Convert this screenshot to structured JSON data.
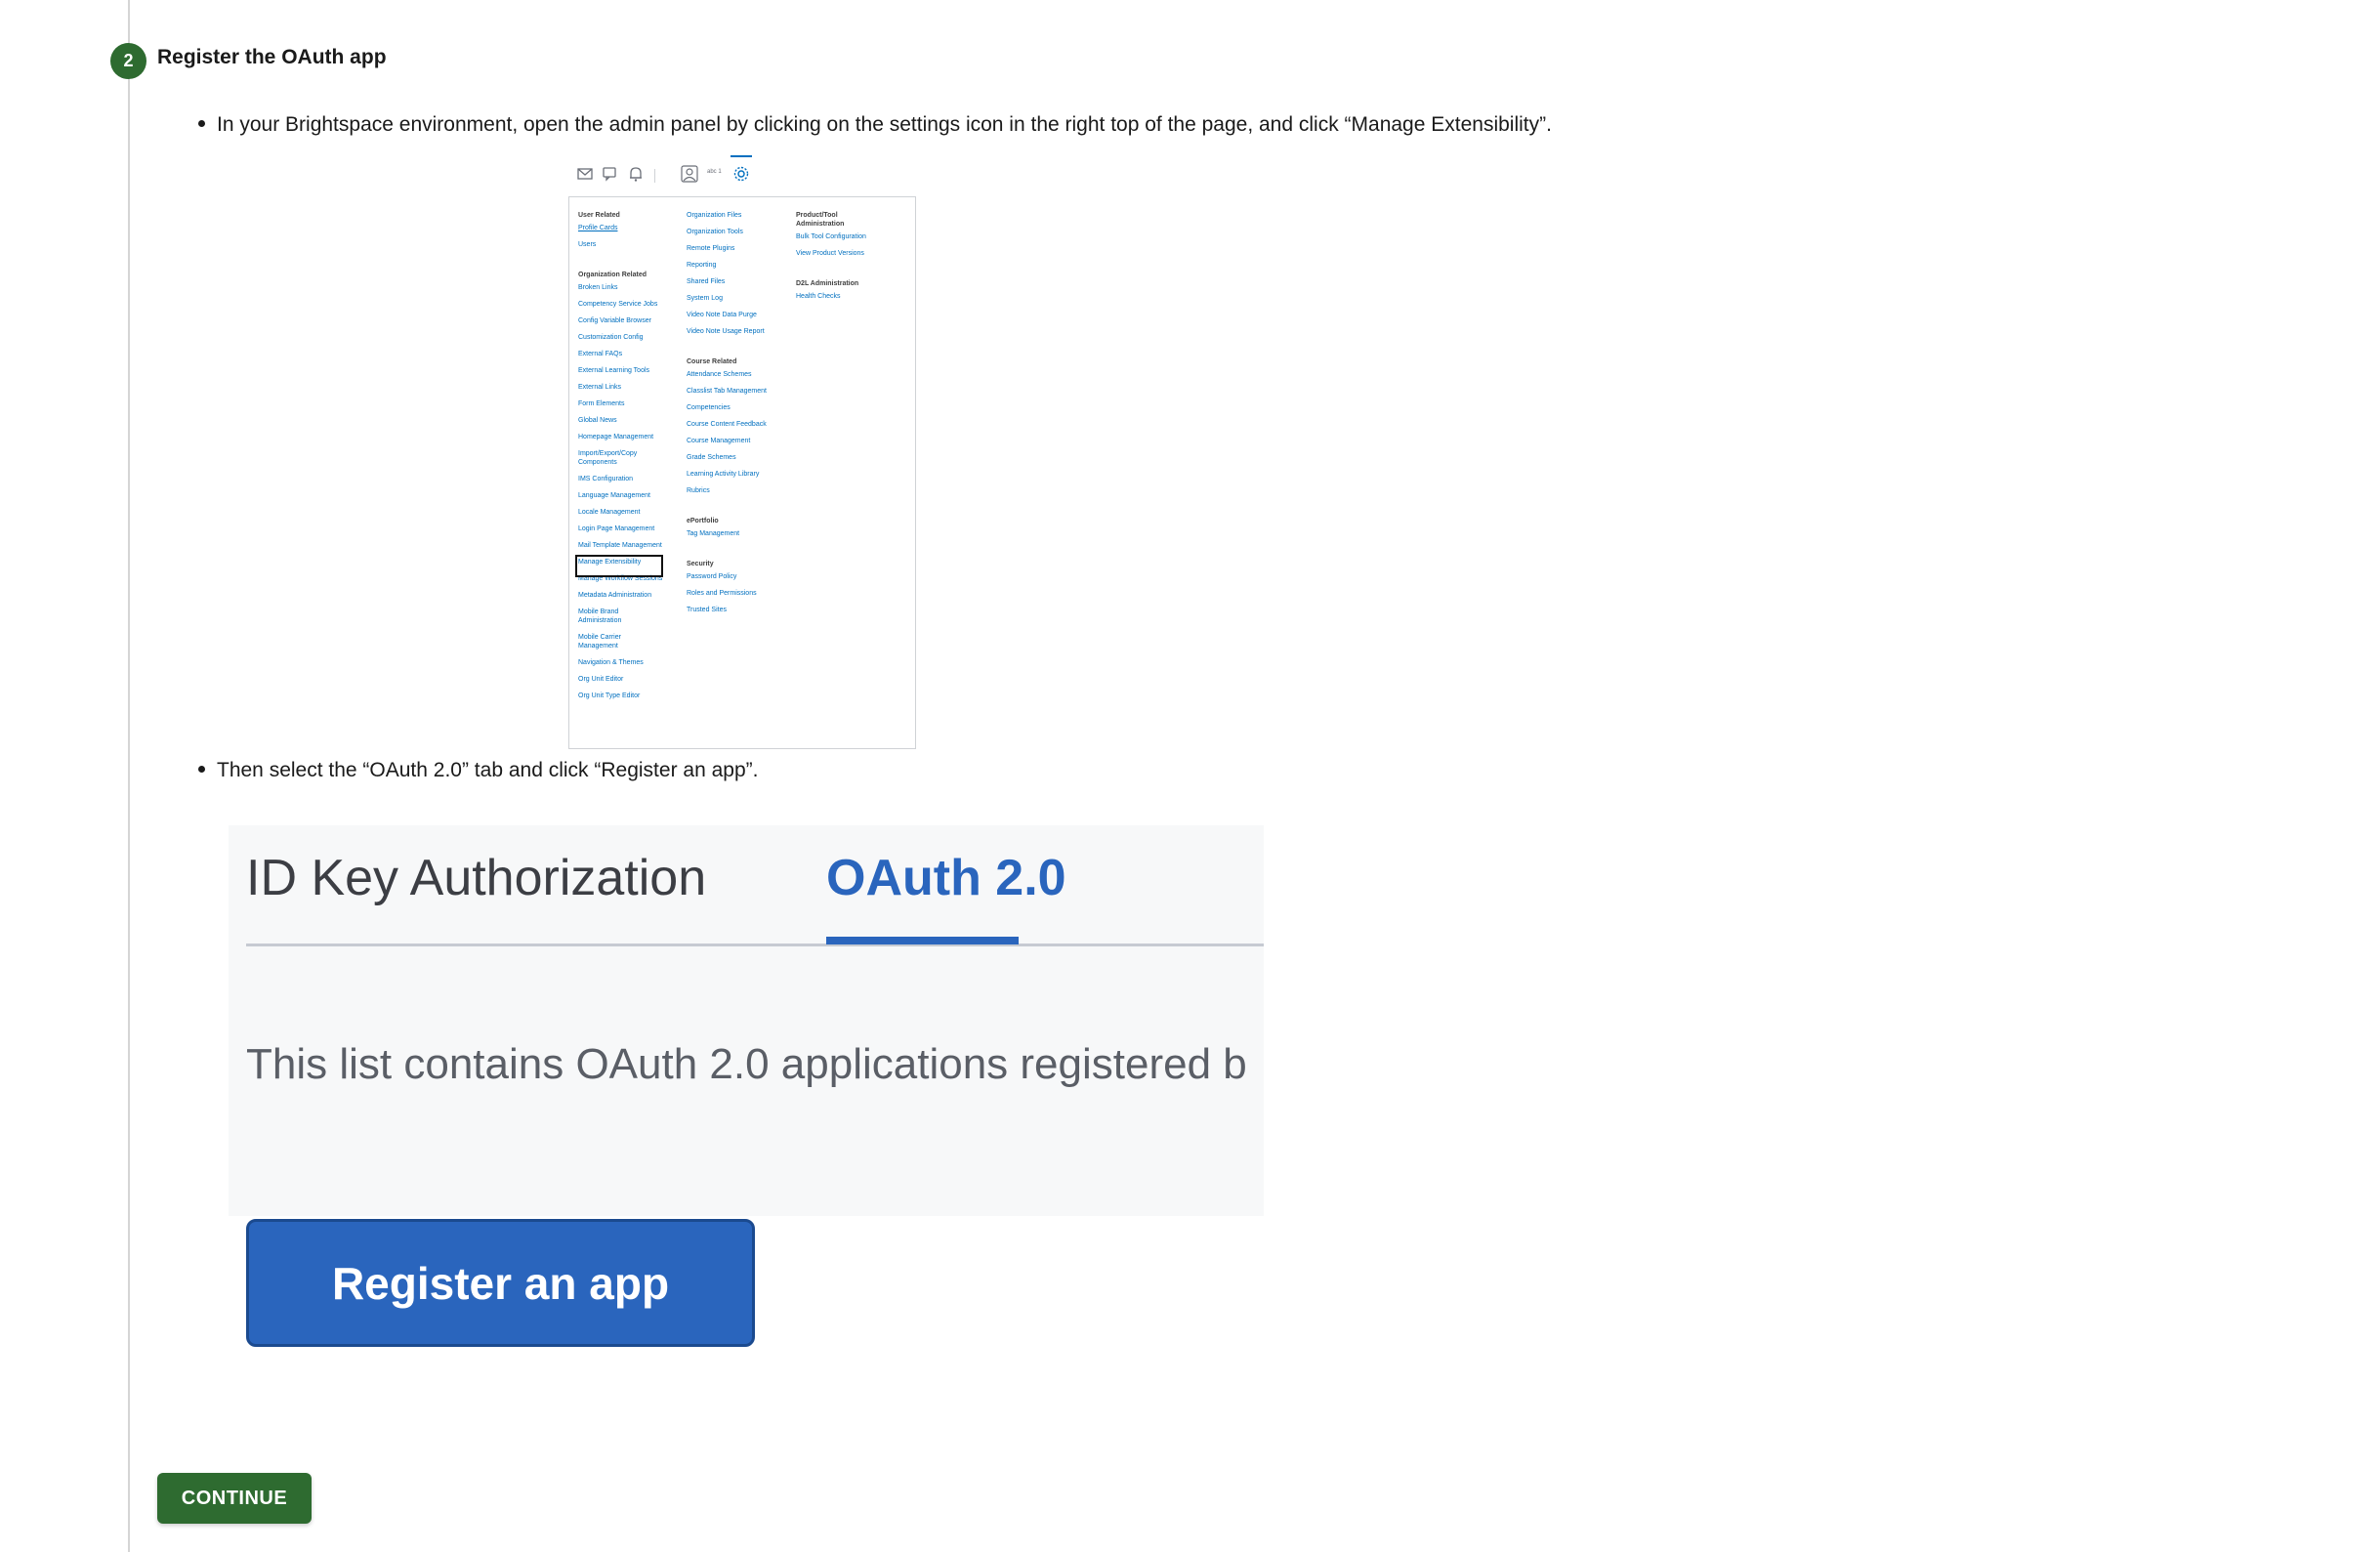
{
  "step": {
    "number": "2",
    "title": "Register the OAuth app"
  },
  "instructions": {
    "bullet1": "In your Brightspace environment, open the admin panel by clicking on the settings icon in the right top of the page, and click “Manage Extensibility”.",
    "bullet2": "Then select the “OAuth 2.0” tab and click “Register an app”."
  },
  "admin_panel": {
    "toolbar_icons": [
      "mail-icon",
      "chat-icon",
      "bell-icon",
      "user-icon",
      "gear-icon"
    ],
    "user_label": "abc 1",
    "col1": {
      "user_related": "User Related",
      "profile_cards": "Profile Cards",
      "users": "Users",
      "org_related": "Organization Related",
      "items": [
        "Broken Links",
        "Competency Service Jobs",
        "Config Variable Browser",
        "Customization Config",
        "External FAQs",
        "External Learning Tools",
        "External Links",
        "Form Elements",
        "Global News",
        "Homepage Management",
        "Import/Export/Copy Components",
        "IMS Configuration",
        "Language Management",
        "Locale Management",
        "Login Page Management",
        "Mail Template Management",
        "Manage Extensibility",
        "Manage Workflow Sessions",
        "Metadata Administration",
        "Mobile Brand Administration",
        "Mobile Carrier Management",
        "Navigation & Themes",
        "Org Unit Editor",
        "Org Unit Type Editor"
      ]
    },
    "col2": {
      "org_items": [
        "Organization Files",
        "Organization Tools",
        "Remote Plugins",
        "Reporting",
        "Shared Files",
        "System Log",
        "Video Note Data Purge",
        "Video Note Usage Report"
      ],
      "course_related": "Course Related",
      "course_items": [
        "Attendance Schemes",
        "Classlist Tab Management",
        "Competencies",
        "Course Content Feedback",
        "Course Management",
        "Grade Schemes",
        "Learning Activity Library",
        "Rubrics"
      ],
      "eportfolio": "ePortfolio",
      "eportfolio_items": [
        "Tag Management"
      ],
      "security": "Security",
      "security_items": [
        "Password Policy",
        "Roles and Permissions",
        "Trusted Sites"
      ]
    },
    "col3": {
      "product_tool": "Product/Tool Administration",
      "product_items": [
        "Bulk Tool Configuration",
        "View Product Versions"
      ],
      "d2l_admin": "D2L Administration",
      "d2l_items": [
        "Health Checks"
      ]
    }
  },
  "oauth_screen": {
    "tab_id_key": "ID Key Authorization",
    "tab_oauth": "OAuth 2.0",
    "description": "This list contains OAuth 2.0 applications registered b",
    "register_button": "Register an app"
  },
  "continue_button": "CONTINUE",
  "colors": {
    "step_green": "#2e6b30",
    "link_blue": "#006fbf",
    "brand_blue": "#2a65bd"
  }
}
